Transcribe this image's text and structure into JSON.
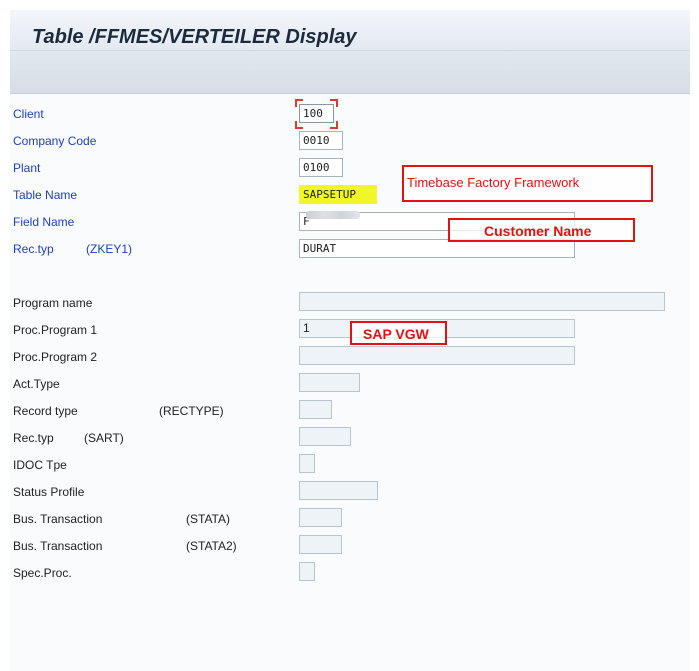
{
  "title": "Table /FFMES/VERTEILER Display",
  "key_fields": [
    {
      "label": "Client",
      "value": "100"
    },
    {
      "label": "Company Code",
      "value": "0010"
    },
    {
      "label": "Plant",
      "value": "0100"
    },
    {
      "label": "Table Name",
      "value": "SAPSETUP"
    },
    {
      "label": "Field Name",
      "value": "F"
    },
    {
      "label": "Rec.typ",
      "tech": "(ZKEY1)",
      "value": "DURAT"
    }
  ],
  "data_fields": [
    {
      "label": "Program name",
      "value": ""
    },
    {
      "label": "Proc.Program 1",
      "value": "1"
    },
    {
      "label": "Proc.Program 2",
      "value": ""
    },
    {
      "label": "Act.Type",
      "value": ""
    },
    {
      "label": "Record type",
      "tech": "(RECTYPE)",
      "value": ""
    },
    {
      "label": "Rec.typ",
      "tech": "(SART)",
      "value": ""
    },
    {
      "label": "IDOC Tpe",
      "value": ""
    },
    {
      "label": "Status Profile",
      "value": ""
    },
    {
      "label": "Bus. Transaction",
      "tech": "(STATA)",
      "value": ""
    },
    {
      "label": "Bus. Transaction",
      "tech": "(STATA2)",
      "value": ""
    },
    {
      "label": "Spec.Proc.",
      "value": ""
    }
  ],
  "annotations": {
    "framework": "Timebase Factory Framework",
    "customer": "Customer Name",
    "sap": "SAP VGW"
  },
  "colors": {
    "key_label": "#1f3fbf",
    "annotation": "#e21212",
    "highlight": "#f0f62a"
  }
}
